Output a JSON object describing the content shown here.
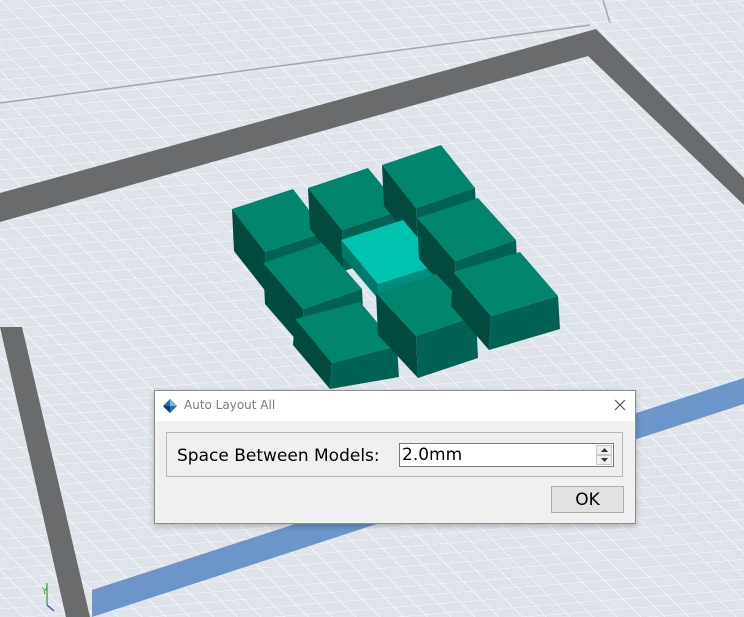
{
  "dialog": {
    "title": "Auto Layout All",
    "space_label": "Space Between Models:",
    "space_value": "2.0mm",
    "ok_label": "OK"
  },
  "scene": {
    "axis_label": "Y",
    "colors": {
      "background": "#dfe4ea",
      "grid_line": "#ffffff",
      "platform_border": "#6a6b6d",
      "axis_strip": "#6c95c9",
      "model": "#007a64",
      "model_selected": "#00c4b0"
    }
  }
}
